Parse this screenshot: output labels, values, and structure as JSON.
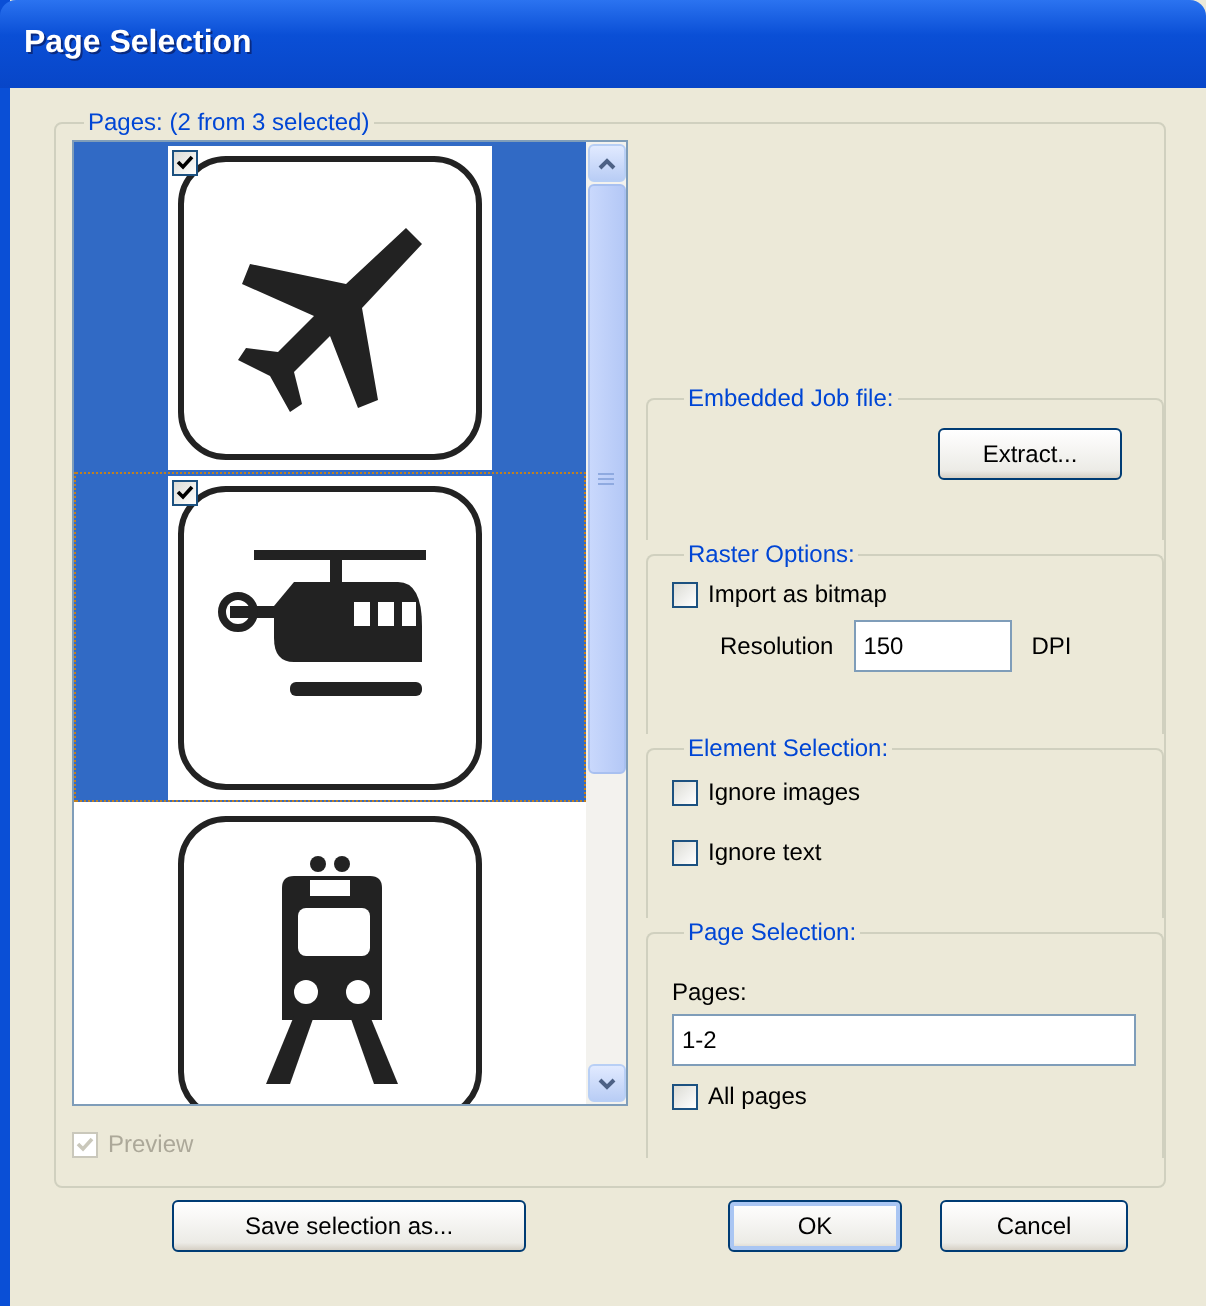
{
  "window": {
    "title": "Page Selection"
  },
  "pages_group": {
    "legend": "Pages: (2 from 3 selected)"
  },
  "pages": [
    {
      "kind": "airplane",
      "selected": true,
      "checked": true,
      "focused": false
    },
    {
      "kind": "helicopter",
      "selected": true,
      "checked": true,
      "focused": true
    },
    {
      "kind": "train",
      "selected": false,
      "checked": false,
      "focused": false
    }
  ],
  "preview": {
    "label": "Preview",
    "checked": true,
    "disabled": true
  },
  "embedded_job": {
    "legend": "Embedded Job file:",
    "button": "Extract..."
  },
  "raster_options": {
    "legend": "Raster Options:",
    "import_bitmap": {
      "label": "Import as bitmap",
      "checked": false
    },
    "resolution_label": "Resolution",
    "resolution": "150",
    "unit": "DPI"
  },
  "element_selection": {
    "legend": "Element Selection:",
    "options": [
      {
        "label": "Ignore images",
        "checked": false
      },
      {
        "label": "Ignore text",
        "checked": false
      }
    ]
  },
  "page_selection": {
    "legend": "Page Selection:",
    "pages_label": "Pages:",
    "pages_value": "1-2",
    "all_pages": {
      "label": "All pages",
      "checked": false
    }
  },
  "buttons": [
    {
      "label": "Save selection as...",
      "default": false
    },
    {
      "label": "OK",
      "default": true
    },
    {
      "label": "Cancel",
      "default": false
    }
  ]
}
